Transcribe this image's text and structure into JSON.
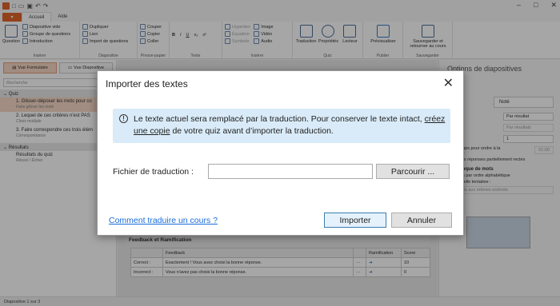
{
  "ribbon": {
    "tabs": [
      "Accueil",
      "Aide"
    ],
    "file_label": "▾",
    "groups": [
      {
        "name": "Insérer",
        "big": "Question",
        "items": [
          "Diapositive vide",
          "Groupe de questions",
          "Introduction"
        ]
      },
      {
        "name": "Diapositive",
        "items": [
          "Dupliquer",
          "Lien",
          "Import de questions"
        ]
      },
      {
        "name": "Presse-papier",
        "items": [
          "Couper",
          "Copier",
          "Coller"
        ]
      },
      {
        "name": "Texte",
        "items": [
          "B",
          "I",
          "U",
          "x₂",
          "x²"
        ]
      },
      {
        "name": "Insérer",
        "items": [
          "Hyperlien",
          "Équation",
          "Symbole",
          "Image",
          "Vidéo",
          "Audio"
        ]
      },
      {
        "name": "Quiz",
        "big_items": [
          "Traduction",
          "Propriétés",
          "Lecteur"
        ]
      },
      {
        "name": "Publier",
        "big": "Prévisualiser"
      },
      {
        "name": "Sauvegarder",
        "big": "Sauvegarder et retourner au cours"
      }
    ]
  },
  "left": {
    "tab_form": "Vue Formulaire",
    "tab_slide": "Vue Diapositive",
    "search_placeholder": "Recherche",
    "section_quiz": "Quiz",
    "items": [
      {
        "title": "1. Glisser-déposer les mots pour co",
        "sub": "Faire glisser les mots"
      },
      {
        "title": "2. Lequel de ces critères n'est PAS",
        "sub": "Choix multiple"
      },
      {
        "title": "3. Faire correspondre ces trois élém",
        "sub": "Correspondance"
      }
    ],
    "section_results": "Résultats",
    "result_item": {
      "title": "Résultats du quiz",
      "sub": "Réussi / Échec"
    }
  },
  "right": {
    "title": "Options de diapositives",
    "score_value": "Noté",
    "feedback_value": "Par résultat",
    "score_mode": "Par résultats",
    "attempts": "1",
    "time_label": "iter le temps pour ondre à la question :",
    "time_value": "01:00",
    "partial": "cepter des réponses partiellement rectes",
    "wordbank_title": "s de banque de mots",
    "wordbank_opt1": "r les mots par ordre alphabétique",
    "wordbank_opt2": "une nouvelle tentative :",
    "wordbank_opt3": "r les mots aux mêmes endroits"
  },
  "feedback": {
    "title": "Feedback et Ramification",
    "headers": [
      "",
      "Feedback",
      "",
      "Ramification",
      "Score"
    ],
    "rows": [
      {
        "label": "Correct :",
        "text": "Exactement ! Vous avez choisi la bonne réponse.",
        "score": "10"
      },
      {
        "label": "Incorrect :",
        "text": "Vous n'avez pas choisi la bonne réponse.",
        "score": "0"
      }
    ]
  },
  "status": "Diapositive 1 sur 3",
  "dialog": {
    "title": "Importer des textes",
    "info_before": "Le texte actuel sera remplacé par la traduction. Pour conserver le texte intact, ",
    "info_link": "créez une copie",
    "info_after": " de votre quiz avant d’importer la traduction.",
    "file_label": "Fichier de traduction :",
    "file_value": "",
    "browse_label": "Parcourir ...",
    "help_link": "Comment traduire un cours ?",
    "import_label": "Importer",
    "cancel_label": "Annuler"
  },
  "colors": {
    "accent": "#e2652c",
    "info_bg": "#d9ebf8",
    "link": "#1a6bd8"
  }
}
